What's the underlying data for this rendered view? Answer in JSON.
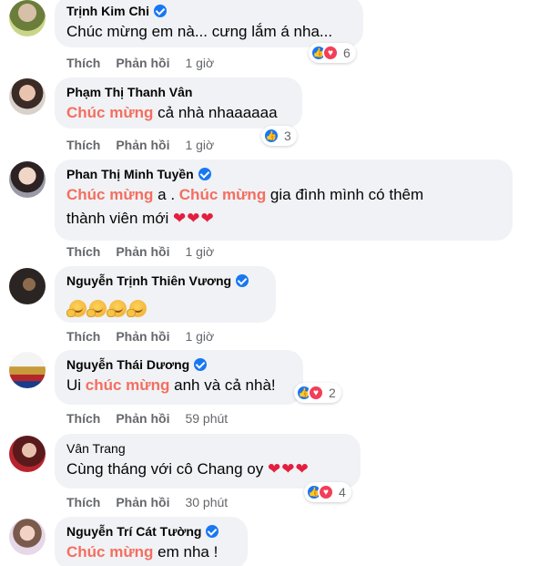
{
  "actions": {
    "like": "Thích",
    "reply": "Phản hồi"
  },
  "comments": [
    {
      "name": "Trịnh Kim Chi",
      "verified": true,
      "line1_parts": [
        "Chúc mừng em nà... cưng lắm á nha..."
      ],
      "time": "1 giờ",
      "reaction_count": "6"
    },
    {
      "name": "Phạm Thị Thanh Vân",
      "verified": false,
      "hl1": "Chúc mừng",
      "rest1": " cả nhà nhaaaaaa",
      "time": "1 giờ",
      "reaction_count": "3"
    },
    {
      "name": "Phan Thị Minh Tuyền",
      "verified": true,
      "hl1": "Chúc mừng",
      "mid1": " a . ",
      "hl2": "Chúc mừng",
      "rest1": " gia đình mình có thêm",
      "line2": "thành viên mới ",
      "hearts": "❤❤❤",
      "time": "1 giờ"
    },
    {
      "name": "Nguyễn Trịnh Thiên Vương",
      "verified": true,
      "time": "1 giờ"
    },
    {
      "name": "Nguyễn Thái Dương",
      "verified": true,
      "pre1": "Ui ",
      "hl1": "chúc mừng",
      "rest1": " anh và cả nhà!",
      "time": "59 phút",
      "reaction_count": "2"
    },
    {
      "name": "Vân Trang",
      "verified": false,
      "text": "Cùng tháng với cô Chang oy ",
      "hearts": "❤❤❤",
      "time": "30 phút",
      "reaction_count": "4"
    },
    {
      "name": "Nguyễn Trí Cát Tường",
      "verified": true,
      "hl1": "Chúc mừng",
      "rest1": " em nha !"
    }
  ]
}
